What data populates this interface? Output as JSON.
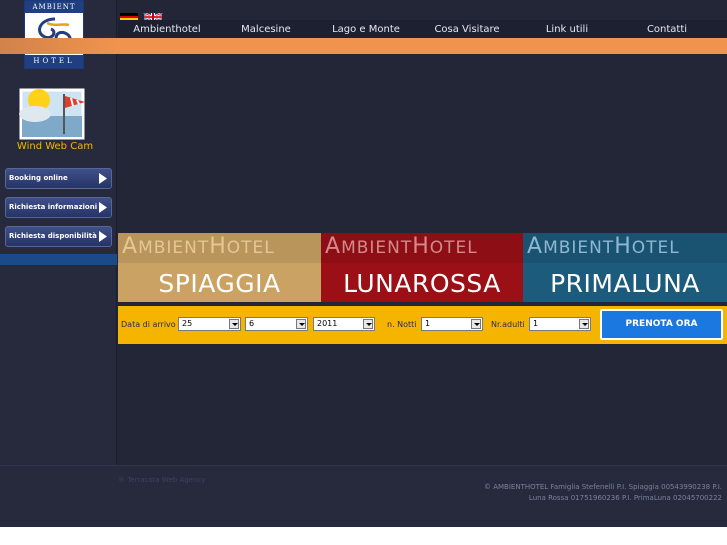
{
  "logo": {
    "top_text": "AMBIENT",
    "bottom_text": "HOTEL"
  },
  "sidebar": {
    "webcam_label": "Wind Web Cam",
    "buttons": [
      {
        "label": "Booking online"
      },
      {
        "label": "Richiesta informazioni"
      },
      {
        "label": "Richiesta disponibilità"
      }
    ]
  },
  "nav": {
    "items": [
      {
        "label": "Ambienthotel"
      },
      {
        "label": "Malcesine"
      },
      {
        "label": "Lago e Monte"
      },
      {
        "label": "Cosa Visitare"
      },
      {
        "label": "Link utili"
      },
      {
        "label": "Contatti"
      }
    ]
  },
  "hotels": [
    {
      "brand_a": "A",
      "brand_b": "MBIENT",
      "brand_c": "H",
      "brand_d": "OTEL",
      "name": "SPIAGGIA",
      "color": "#c9a264",
      "brand_color": "#e3c795"
    },
    {
      "brand_a": "A",
      "brand_b": "MBIENT",
      "brand_c": "H",
      "brand_d": "OTEL",
      "name": "LUNAROSSA",
      "color": "#9b1017",
      "brand_color": "#d38a8a"
    },
    {
      "brand_a": "A",
      "brand_b": "MBIENT",
      "brand_c": "H",
      "brand_d": "OTEL",
      "name": "PRIMALUNA",
      "color": "#1d5b7c",
      "brand_color": "#8fb7cf"
    }
  ],
  "booking": {
    "arrival_label": "Data di arrivo",
    "day": "25",
    "month": "6",
    "year": "2011",
    "nights_label": "n. Notti",
    "nights": "1",
    "adults_label": "Nr.adulti",
    "adults": "1",
    "submit": "PRENOTA ORA"
  },
  "footer": {
    "credit": "® Terracota Web Agency",
    "copyright_line1": "© AMBIENTHOTEL Famiglia Stefenelli P.I. Spiaggia 00543990238 P.I.",
    "copyright_line2": "Luna Rossa 01751960236 P.I. PrimaLuna 02045700222"
  }
}
